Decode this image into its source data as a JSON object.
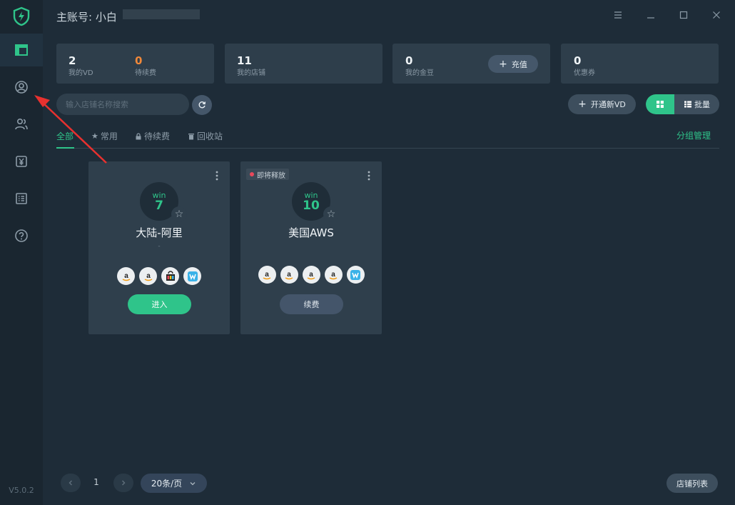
{
  "app": {
    "title_prefix": "主账号:",
    "username": "小白",
    "version": "V5.0.2"
  },
  "sidebar": {
    "items": [
      {
        "name": "dashboard",
        "icon": "layout-icon",
        "active": true
      },
      {
        "name": "account",
        "icon": "user-circle-icon",
        "active": false
      },
      {
        "name": "members",
        "icon": "users-icon",
        "active": false
      },
      {
        "name": "billing",
        "icon": "yen-icon",
        "active": false
      },
      {
        "name": "list",
        "icon": "list-icon",
        "active": false
      },
      {
        "name": "help",
        "icon": "help-circle-icon",
        "active": false
      }
    ]
  },
  "stats": {
    "my_vd": {
      "value": "2",
      "label": "我的VD"
    },
    "pending_renew": {
      "value": "0",
      "label": "待续费"
    },
    "my_shops": {
      "value": "11",
      "label": "我的店铺"
    },
    "my_beans": {
      "value": "0",
      "label": "我的金豆"
    },
    "recharge_label": "充值",
    "coupons": {
      "value": "0",
      "label": "优惠券"
    }
  },
  "toolbar": {
    "search_placeholder": "输入店铺名称搜索",
    "open_vd_label": "开通新VD",
    "batch_label": "批量"
  },
  "tabs": [
    {
      "label": "全部",
      "active": true,
      "icon": ""
    },
    {
      "label": "常用",
      "active": false,
      "icon": "star-icon"
    },
    {
      "label": "待续费",
      "active": false,
      "icon": "lock-icon"
    },
    {
      "label": "回收站",
      "active": false,
      "icon": "trash-icon"
    }
  ],
  "group_management_label": "分组管理",
  "cards": [
    {
      "os": "win",
      "version": "7",
      "name": "大陆-阿里",
      "subtitle": "-",
      "badge": "",
      "platforms": [
        "amazon-icon",
        "amazon-icon",
        "shop-icon",
        "wish-icon"
      ],
      "button": "进入",
      "button_type": "enter"
    },
    {
      "os": "win",
      "version": "10",
      "name": "美国AWS",
      "subtitle": "",
      "badge": "即将释放",
      "platforms": [
        "amazon-icon",
        "amazon-icon",
        "amazon-icon",
        "amazon-icon",
        "wish-icon"
      ],
      "button": "续费",
      "button_type": "renew"
    }
  ],
  "pagination": {
    "current_page": "1",
    "page_size_label": "20条/页"
  },
  "shop_list_label": "店铺列表",
  "colors": {
    "accent": "#2fc48a",
    "warning": "#f0883a",
    "danger": "#e8495b",
    "annotation": "#e8312f"
  }
}
